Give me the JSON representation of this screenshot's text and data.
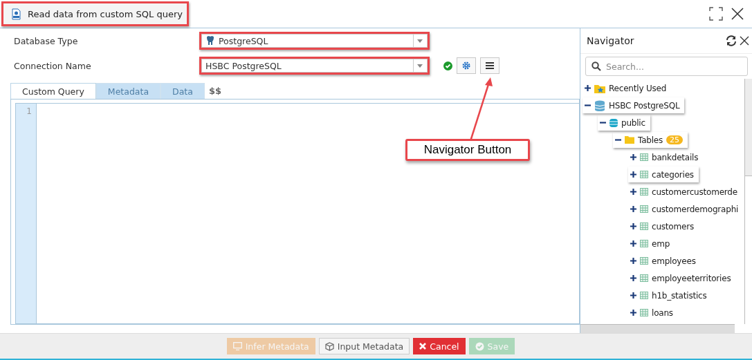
{
  "window": {
    "title": "Read data from custom SQL query",
    "highlighted": true
  },
  "form": {
    "fields": [
      {
        "label": "Database Type",
        "value": "PostgreSQL",
        "kind": "db-type",
        "highlighted": true
      },
      {
        "label": "Connection Name",
        "value": "HSBC PostgreSQL",
        "kind": "connection",
        "highlighted": true,
        "connected": true
      }
    ]
  },
  "tabs": [
    {
      "label": "Custom Query",
      "selected": true
    },
    {
      "label": "Metadata",
      "selected": false
    },
    {
      "label": "Data",
      "selected": false
    }
  ],
  "tab_extra": "$$",
  "editor": {
    "line_numbers": [
      "1"
    ]
  },
  "callout": {
    "text": "Navigator Button"
  },
  "navigator": {
    "title": "Navigator",
    "search": {
      "placeholder": "Search..."
    },
    "tree": [
      {
        "label": "Recently Used",
        "kind": "recent",
        "expanded": false,
        "highlighted": false
      },
      {
        "label": "HSBC PostgreSQL",
        "kind": "database",
        "expanded": true,
        "highlighted": true,
        "children": [
          {
            "label": "public",
            "kind": "schema",
            "expanded": true,
            "highlighted": true,
            "children": [
              {
                "label": "Tables",
                "kind": "folder",
                "badge": "25",
                "expanded": true,
                "highlighted": true,
                "children": [
                  {
                    "label": "bankdetails",
                    "kind": "table",
                    "expanded": false,
                    "highlighted": false
                  },
                  {
                    "label": "categories",
                    "kind": "table",
                    "expanded": false,
                    "highlighted": true
                  },
                  {
                    "label": "customercustomerde",
                    "kind": "table",
                    "expanded": false,
                    "highlighted": false
                  },
                  {
                    "label": "customerdemographi",
                    "kind": "table",
                    "expanded": false,
                    "highlighted": false
                  },
                  {
                    "label": "customers",
                    "kind": "table",
                    "expanded": false,
                    "highlighted": false
                  },
                  {
                    "label": "emp",
                    "kind": "table",
                    "expanded": false,
                    "highlighted": false
                  },
                  {
                    "label": "employees",
                    "kind": "table",
                    "expanded": false,
                    "highlighted": false
                  },
                  {
                    "label": "employeeterritories",
                    "kind": "table",
                    "expanded": false,
                    "highlighted": false
                  },
                  {
                    "label": "h1b_statistics",
                    "kind": "table",
                    "expanded": false,
                    "highlighted": false
                  },
                  {
                    "label": "loans",
                    "kind": "table",
                    "expanded": false,
                    "highlighted": false
                  }
                ]
              }
            ]
          }
        ]
      }
    ]
  },
  "buttons": [
    {
      "label": "Infer Metadata",
      "kind": "infer",
      "disabled": true
    },
    {
      "label": "Input Metadata",
      "kind": "input",
      "disabled": false
    },
    {
      "label": "Cancel",
      "kind": "cancel",
      "disabled": false
    },
    {
      "label": "Save",
      "kind": "save",
      "disabled": true
    }
  ]
}
